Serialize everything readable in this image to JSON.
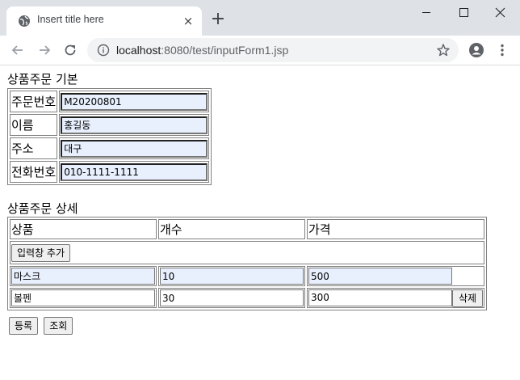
{
  "browser": {
    "tab_title": "Insert title here",
    "tab_close": "×",
    "new_tab": "+",
    "url_host": "localhost",
    "url_rest": ":8080/test/inputForm1.jsp"
  },
  "page": {
    "basic_title": "상품주문 기본",
    "basic_rows": [
      {
        "label": "주문번호",
        "value": "M20200801"
      },
      {
        "label": "이름",
        "value": "홍길동"
      },
      {
        "label": "주소",
        "value": "대구"
      },
      {
        "label": "전화번호",
        "value": "010-1111-1111"
      }
    ],
    "detail_title": "상품주문 상세",
    "detail_headers": [
      "상품",
      "개수",
      "가격"
    ],
    "add_button": "입력창 추가",
    "detail_rows": [
      {
        "product": "마스크",
        "count": "10",
        "price": "500"
      },
      {
        "product": "볼펜",
        "count": "30",
        "price": "300",
        "delete": "삭제"
      }
    ],
    "register_button": "등록",
    "search_button": "조회"
  },
  "colors": {
    "autofill_bg": "#e8f0fe",
    "chrome_bg": "#dee1e6",
    "omnibox_bg": "#f1f3f4"
  }
}
